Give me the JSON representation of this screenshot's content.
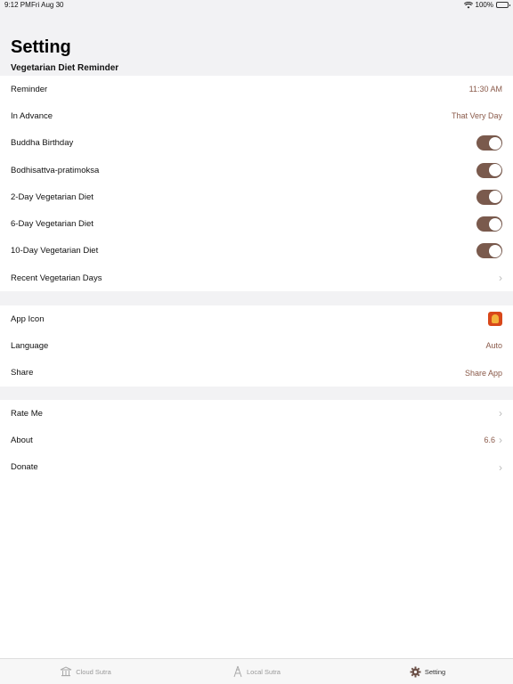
{
  "status_bar": {
    "time": "9:12 PM",
    "date": "Fri Aug 30",
    "battery": "100%"
  },
  "title": "Setting",
  "section_header": "Vegetarian Diet Reminder",
  "group1": {
    "reminder": {
      "label": "Reminder",
      "value": "11:30 AM"
    },
    "in_advance": {
      "label": "In Advance",
      "value": "That Very Day"
    },
    "buddha_birthday": {
      "label": "Buddha Birthday",
      "on": true
    },
    "bodhisattva": {
      "label": "Bodhisattva-pratimoksa",
      "on": true
    },
    "two_day": {
      "label": "2-Day Vegetarian Diet",
      "on": true
    },
    "six_day": {
      "label": "6-Day Vegetarian Diet",
      "on": true
    },
    "ten_day": {
      "label": "10-Day Vegetarian Diet",
      "on": true
    },
    "recent_days": {
      "label": "Recent Vegetarian Days"
    }
  },
  "group2": {
    "app_icon": {
      "label": "App Icon"
    },
    "language": {
      "label": "Language",
      "value": "Auto"
    },
    "share": {
      "label": "Share",
      "value": "Share App"
    }
  },
  "group3": {
    "rate_me": {
      "label": "Rate Me"
    },
    "about": {
      "label": "About",
      "value": "6.6"
    },
    "donate": {
      "label": "Donate"
    }
  },
  "tabs": [
    {
      "label": "Cloud Sutra",
      "icon": "temple-icon"
    },
    {
      "label": "Local Sutra",
      "icon": "pagoda-icon"
    },
    {
      "label": "Setting",
      "icon": "gear-icon"
    }
  ],
  "colors": {
    "accent": "#7a5a4d",
    "value_text": "#8a5a4a"
  }
}
